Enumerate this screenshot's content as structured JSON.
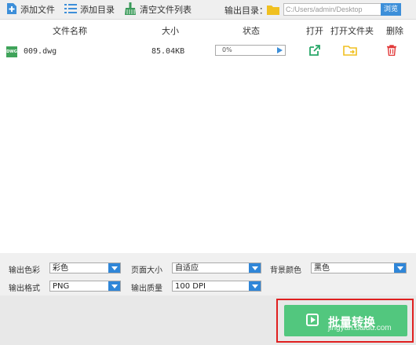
{
  "toolbar": {
    "add_file": "添加文件",
    "add_dir": "添加目录",
    "clear_list": "清空文件列表",
    "output_dir_label": "输出目录：",
    "output_path": "C:/Users/admin/Desktop",
    "browse": "浏览"
  },
  "columns": {
    "name": "文件名称",
    "size": "大小",
    "status": "状态",
    "open": "打开",
    "open_folder": "打开文件夹",
    "delete": "删除"
  },
  "files": [
    {
      "icon_text": "DWG",
      "name": "009.dwg",
      "size": "85.04KB",
      "progress_text": "0%",
      "progress": 0
    }
  ],
  "settings": {
    "color_label": "输出色彩",
    "color_value": "彩色",
    "page_size_label": "页面大小",
    "page_size_value": "自适应",
    "bg_color_label": "背景颜色",
    "bg_color_value": "黑色",
    "format_label": "输出格式",
    "format_value": "PNG",
    "quality_label": "输出质量",
    "quality_value": "100 DPI"
  },
  "convert_button": "批量转换",
  "watermark": "jingyan.baidu.com",
  "colors": {
    "accent": "#3d8fd9",
    "convert": "#52c77e",
    "highlight": "#e02020",
    "open_icon": "#2aa86a",
    "folder_icon": "#f0c020",
    "delete_icon": "#e23b3b"
  }
}
